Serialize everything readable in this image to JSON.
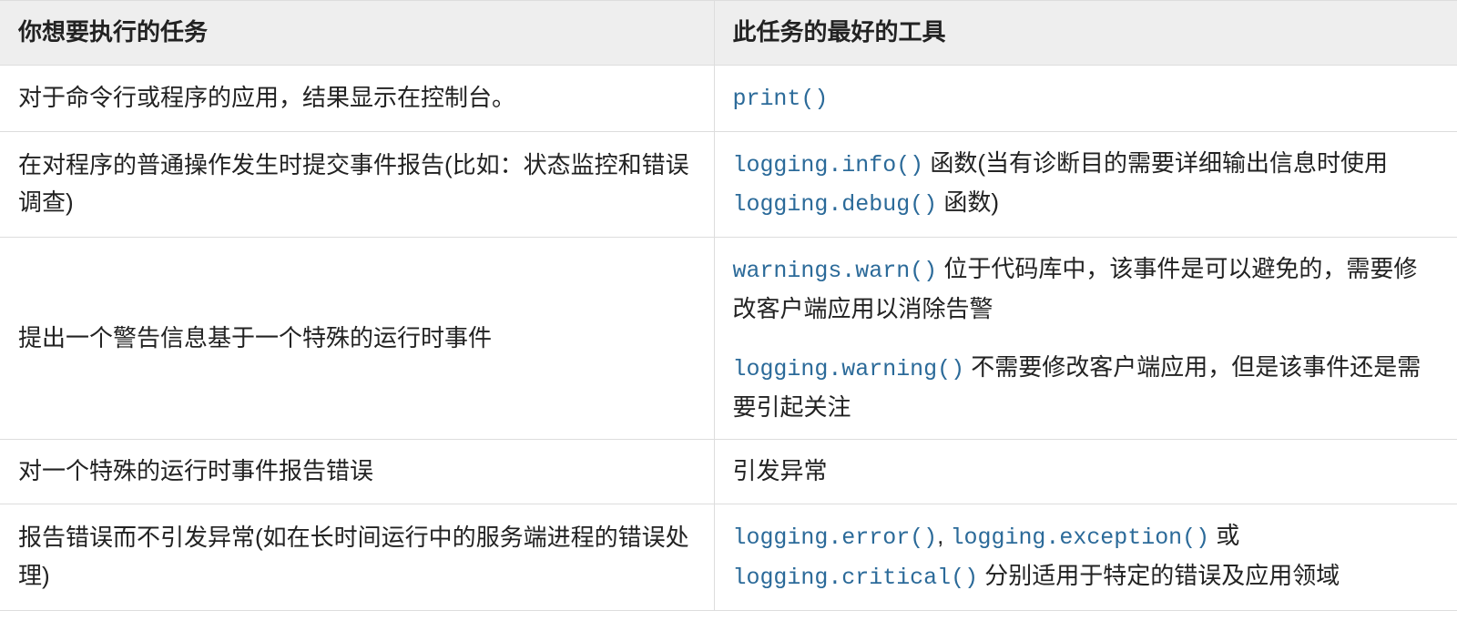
{
  "table": {
    "headers": {
      "col1": "你想要执行的任务",
      "col2": "此任务的最好的工具"
    },
    "rows": [
      {
        "task": "对于命令行或程序的应用，结果显示在控制台。",
        "tool": {
          "p1": {
            "code1": "print()"
          }
        }
      },
      {
        "task": "在对程序的普通操作发生时提交事件报告(比如：状态监控和错误调查)",
        "tool": {
          "p1": {
            "code1": "logging.info()",
            "text1": " 函数(当有诊断目的需要详细输出信息时使用 ",
            "code2": "logging.debug()",
            "text2": " 函数)"
          }
        }
      },
      {
        "task": "提出一个警告信息基于一个特殊的运行时事件",
        "tool": {
          "p1": {
            "code1": "warnings.warn()",
            "text1": " 位于代码库中，该事件是可以避免的，需要修改客户端应用以消除告警"
          },
          "p2": {
            "code1": "logging.warning()",
            "text1": " 不需要修改客户端应用，但是该事件还是需要引起关注"
          }
        }
      },
      {
        "task": "对一个特殊的运行时事件报告错误",
        "tool": {
          "p1": {
            "text1": "引发异常"
          }
        }
      },
      {
        "task": "报告错误而不引发异常(如在长时间运行中的服务端进程的错误处理)",
        "tool": {
          "p1": {
            "code1": "logging.error()",
            "text1": ", ",
            "code2": "logging.exception()",
            "text2": " 或 ",
            "code3": "logging.critical()",
            "text3": " 分别适用于特定的错误及应用领域"
          }
        }
      }
    ]
  }
}
